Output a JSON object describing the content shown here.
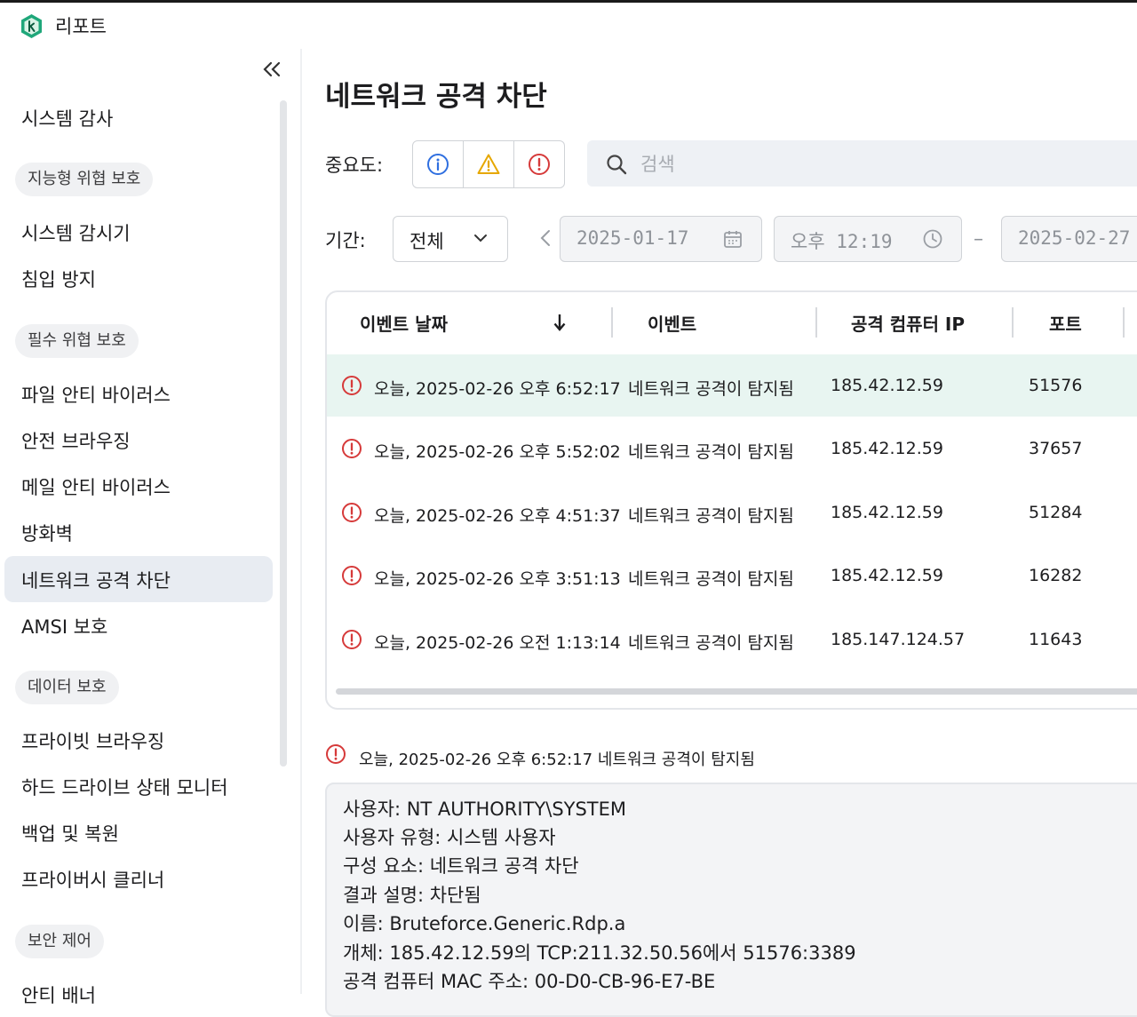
{
  "app": {
    "title": "리포트"
  },
  "sidebar": {
    "items": [
      {
        "label": "시스템 감사",
        "type": "item"
      },
      {
        "label": "지능형 위협 보호",
        "type": "group"
      },
      {
        "label": "시스템 감시기",
        "type": "item"
      },
      {
        "label": "침입 방지",
        "type": "item"
      },
      {
        "label": "필수 위협 보호",
        "type": "group"
      },
      {
        "label": "파일 안티 바이러스",
        "type": "item"
      },
      {
        "label": "안전 브라우징",
        "type": "item"
      },
      {
        "label": "메일 안티 바이러스",
        "type": "item"
      },
      {
        "label": "방화벽",
        "type": "item"
      },
      {
        "label": "네트워크 공격 차단",
        "type": "item",
        "active": true
      },
      {
        "label": "AMSI 보호",
        "type": "item"
      },
      {
        "label": "데이터 보호",
        "type": "group"
      },
      {
        "label": "프라이빗 브라우징",
        "type": "item"
      },
      {
        "label": "하드 드라이브 상태 모니터",
        "type": "item"
      },
      {
        "label": "백업 및 복원",
        "type": "item"
      },
      {
        "label": "프라이버시 클리너",
        "type": "item"
      },
      {
        "label": "보안 제어",
        "type": "group"
      },
      {
        "label": "안티 배너",
        "type": "item"
      }
    ]
  },
  "page": {
    "title": "네트워크 공격 차단"
  },
  "filters": {
    "severity_label": "중요도:",
    "search_placeholder": "검색",
    "period_label": "기간:",
    "period_value": "전체",
    "start_date": "2025-01-17",
    "start_time": "오후 12:19",
    "dash": "–",
    "end_date": "2025-02-27"
  },
  "table": {
    "headers": [
      "이벤트 날짜",
      "이벤트",
      "공격 컴퓨터 IP",
      "포트"
    ],
    "rows": [
      {
        "date": "오늘, 2025-02-26 오후 6:52:17",
        "event": "네트워크 공격이 탐지됨",
        "ip": "185.42.12.59",
        "port": "51576",
        "selected": true
      },
      {
        "date": "오늘, 2025-02-26 오후 5:52:02",
        "event": "네트워크 공격이 탐지됨",
        "ip": "185.42.12.59",
        "port": "37657"
      },
      {
        "date": "오늘, 2025-02-26 오후 4:51:37",
        "event": "네트워크 공격이 탐지됨",
        "ip": "185.42.12.59",
        "port": "51284"
      },
      {
        "date": "오늘, 2025-02-26 오후 3:51:13",
        "event": "네트워크 공격이 탐지됨",
        "ip": "185.42.12.59",
        "port": "16282"
      },
      {
        "date": "오늘, 2025-02-26 오전 1:13:14",
        "event": "네트워크 공격이 탐지됨",
        "ip": "185.147.124.57",
        "port": "11643"
      }
    ]
  },
  "detail": {
    "heading": "오늘, 2025-02-26 오후 6:52:17 네트워크 공격이 탐지됨",
    "lines": [
      "사용자: NT AUTHORITY\\SYSTEM",
      "사용자 유형: 시스템 사용자",
      "구성 요소: 네트워크 공격 차단",
      "결과 설명: 차단됨",
      "이름: Bruteforce.Generic.Rdp.a",
      "개체: 185.42.12.59의 TCP:211.32.50.56에서 51576:3389",
      "공격 컴퓨터 MAC 주소: 00-D0-CB-96-E7-BE"
    ]
  },
  "colors": {
    "info": "#2f6fe0",
    "warning": "#e6a700",
    "critical": "#d63a3a",
    "selected_row": "#e8f5f1",
    "active_nav": "#e8ecf2",
    "brand": "#1fa77a"
  },
  "icons": {
    "logo": "kaspersky-logo-icon",
    "collapse": "double-chevron-left-icon",
    "search": "search-icon",
    "calendar": "calendar-icon",
    "clock": "clock-icon",
    "sort": "arrow-down-icon",
    "event": "critical-alert-icon"
  }
}
